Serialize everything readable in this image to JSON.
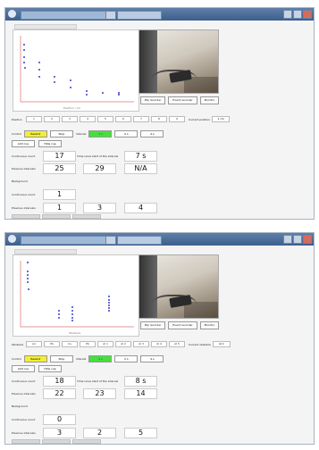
{
  "colors": {
    "accent_yellow": "#f2ee34",
    "accent_green": "#44e03c",
    "points": "#3a3fc8",
    "titlebar": "#3c5f8b"
  },
  "panels": [
    {
      "chart": {
        "xlabel": "Position / cm"
      },
      "buttons": [
        "Bip recorder",
        "Event recorder",
        "Monitor"
      ],
      "axis_row": {
        "label": "Position",
        "buttons": [
          "1",
          "2",
          "3",
          "4",
          "5",
          "6",
          "7",
          "8",
          "9"
        ],
        "current_label": "Current position",
        "current_value": "1 cm"
      },
      "control": {
        "label": "Control",
        "btn1": "Rewind",
        "btn2": "Stop",
        "interval_label": "Interval",
        "btn_green": "1 s",
        "btn_a": "2 s",
        "btn_b": "4 s"
      },
      "small_buttons": [
        "Add cue",
        "Hide cue"
      ],
      "continuous": {
        "label": "Continuous count",
        "value": "17",
        "since_label": "Time since start of the interval",
        "since_value": "7 s"
      },
      "previous": {
        "label": "Previous intervals",
        "values": [
          "25",
          "29",
          "N/A"
        ]
      },
      "background": {
        "heading": "Background",
        "cont_label": "Continuous count",
        "cont_value": "1",
        "prev_label": "Previous intervals",
        "prev_values": [
          "1",
          "3",
          "4"
        ]
      }
    },
    {
      "chart": {
        "xlabel": "Obstacle"
      },
      "buttons": [
        "Bip recorder",
        "Event recorder",
        "Monitor"
      ],
      "axis_row": {
        "label": "Obstacle",
        "buttons": [
          "Air",
          "Pb",
          "Cu",
          "Pb",
          "Al 1",
          "Al 2",
          "Al 3",
          "Al 4",
          "Al 5"
        ],
        "current_label": "Current obstacle",
        "current_value": "Al 1"
      },
      "control": {
        "label": "Control",
        "btn1": "Rewind",
        "btn2": "Stop",
        "interval_label": "Interval",
        "btn_green": "1 s",
        "btn_a": "2 s",
        "btn_b": "4 s"
      },
      "small_buttons": [
        "Add cue",
        "Hide cue"
      ],
      "continuous": {
        "label": "Continuous count",
        "value": "18",
        "since_label": "Time since start of the interval",
        "since_value": "8 s"
      },
      "previous": {
        "label": "Previous intervals",
        "values": [
          "22",
          "23",
          "14"
        ]
      },
      "background": {
        "heading": "Background",
        "cont_label": "Continuous count",
        "cont_value": "0",
        "prev_label": "Previous intervals",
        "prev_values": [
          "3",
          "2",
          "5"
        ]
      }
    }
  ]
}
